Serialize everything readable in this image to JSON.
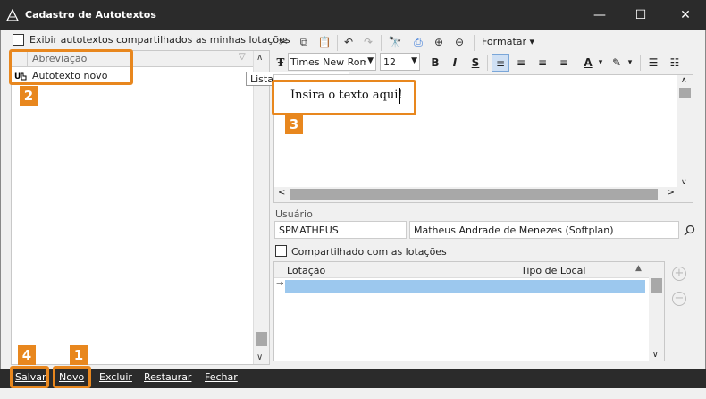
{
  "window": {
    "title": "Cadastro de Autotextos",
    "controls": [
      "—",
      "☐",
      "✕"
    ]
  },
  "left": {
    "show_shared_label": "Exibir autotextos compartilhados as minhas lotações",
    "column_header": "Abreviação",
    "rows": [
      {
        "label": "Autotexto novo"
      }
    ],
    "tooltip": "Lista de Autotextos"
  },
  "toolbar": {
    "format_menu": "Formatar",
    "font_name": "Times New Roma",
    "font_size": "12",
    "bold": "B",
    "italic": "I",
    "underline": "S",
    "font_color": "A"
  },
  "editor": {
    "text": "Insira o texto aqui!"
  },
  "usuario": {
    "label": "Usuário",
    "login": "SPMATHEUS",
    "name": "Matheus Andrade de Menezes (Softplan)"
  },
  "shared": {
    "label": "Compartilhado com as lotações",
    "columns": [
      "Lotação",
      "Tipo de Local"
    ]
  },
  "bottom": {
    "save": "Salvar",
    "new": "Novo",
    "delete": "Excluir",
    "restore": "Restaurar",
    "close": "Fechar"
  },
  "callouts": [
    "1",
    "2",
    "3",
    "4"
  ],
  "colors": {
    "accent": "#e8871e",
    "titlebar": "#2b2b2b",
    "selection": "#9cc8ee"
  }
}
